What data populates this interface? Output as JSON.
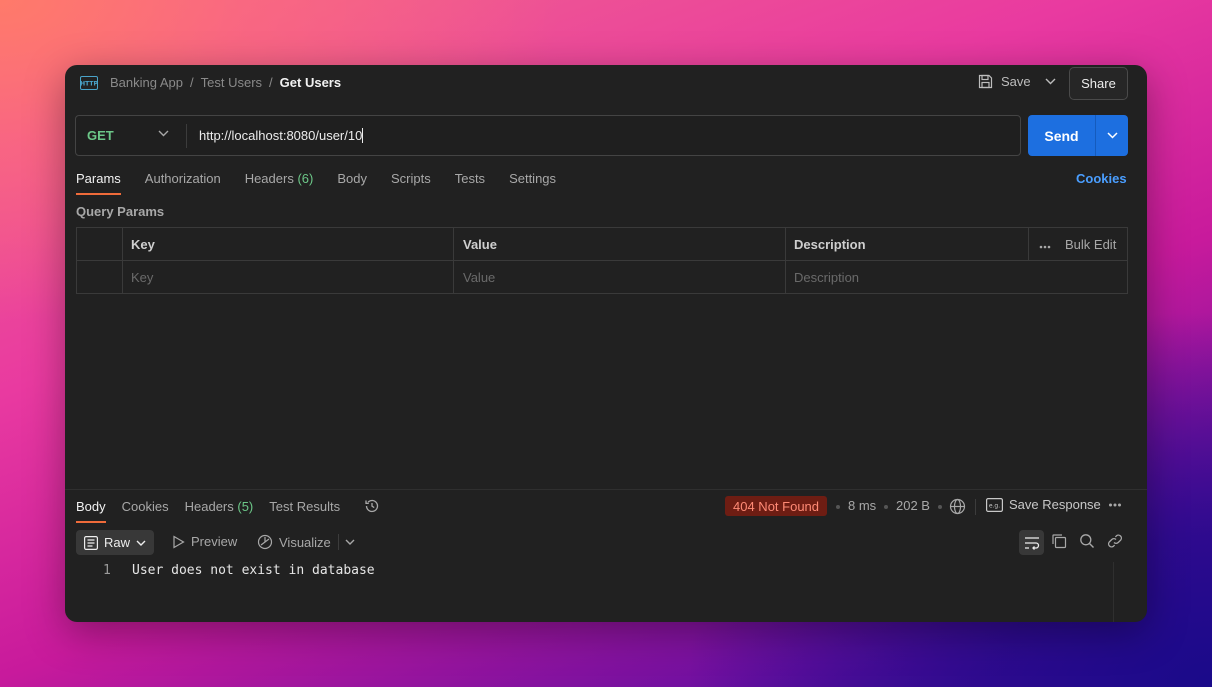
{
  "header": {
    "protocol_icon": "http-icon",
    "breadcrumbs": [
      "Banking App",
      "Test Users"
    ],
    "separator": "/",
    "current": "Get Users",
    "save_label": "Save",
    "share_label": "Share"
  },
  "request": {
    "method": "GET",
    "url": "http://localhost:8080/user/10",
    "send_label": "Send"
  },
  "tabs": {
    "params": "Params",
    "authorization": "Authorization",
    "headers": "Headers",
    "headers_count": "(6)",
    "body": "Body",
    "scripts": "Scripts",
    "tests": "Tests",
    "settings": "Settings",
    "cookies": "Cookies"
  },
  "query_params": {
    "title": "Query Params",
    "columns": [
      "Key",
      "Value",
      "Description"
    ],
    "bulk_edit": "Bulk Edit",
    "placeholders": [
      "Key",
      "Value",
      "Description"
    ]
  },
  "response": {
    "tabs": {
      "body": "Body",
      "cookies": "Cookies",
      "headers": "Headers",
      "headers_count": "(5)",
      "test_results": "Test Results"
    },
    "status": "404 Not Found",
    "time": "8 ms",
    "size": "202 B",
    "save_response": "Save Response",
    "format": "Raw",
    "preview": "Preview",
    "visualize": "Visualize",
    "lines": [
      {
        "number": "1",
        "text": "User does not exist in database"
      }
    ]
  },
  "colors": {
    "method": "#6cc788",
    "send": "#1d6fe0",
    "active_tab": "#ef6b3a",
    "link": "#4a9eff",
    "status_bg": "#6e1d13"
  }
}
